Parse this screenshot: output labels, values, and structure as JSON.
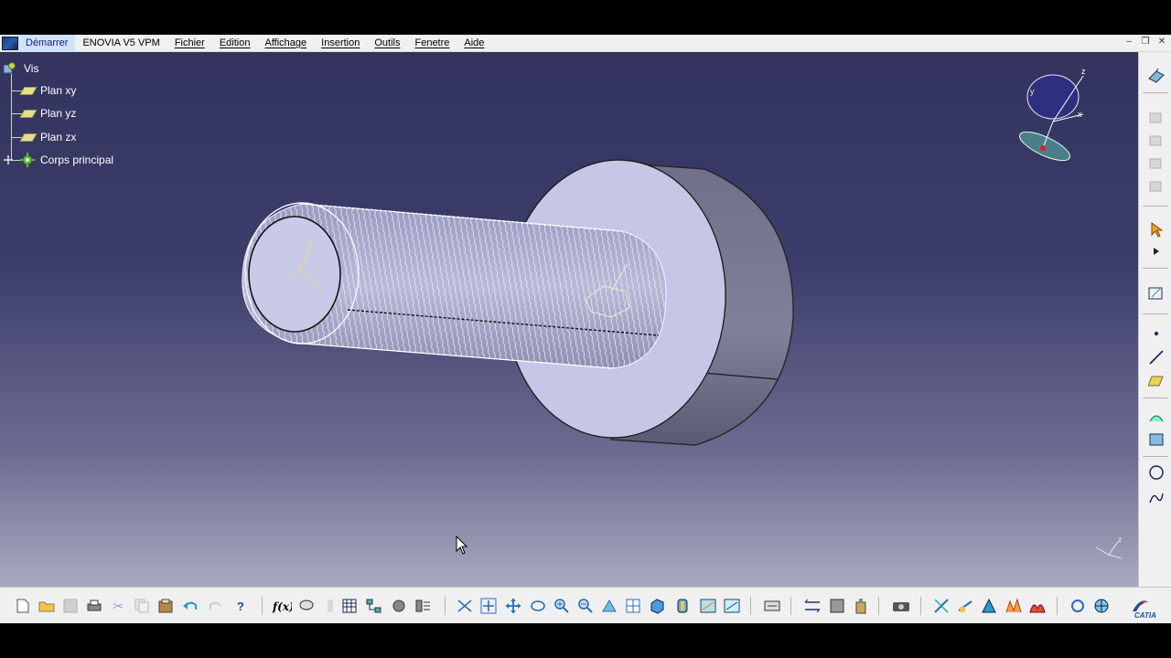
{
  "menu": {
    "items": [
      {
        "label": "Démarrer"
      },
      {
        "label": "ENOVIA V5 VPM"
      },
      {
        "label": "Fichier"
      },
      {
        "label": "Edition"
      },
      {
        "label": "Affichage"
      },
      {
        "label": "Insertion"
      },
      {
        "label": "Outils"
      },
      {
        "label": "Fenetre"
      },
      {
        "label": "Aide"
      }
    ]
  },
  "tree": {
    "root": "Vis",
    "children": [
      "Plan xy",
      "Plan yz",
      "Plan zx",
      "Corps principal"
    ]
  },
  "compass": {
    "x": "x",
    "y": "y",
    "z": "z"
  },
  "brand": "CATIA",
  "colors": {
    "menu_highlight": "#cfe3f7",
    "viewport_top": "#33335e",
    "viewport_bottom": "#a9a9be",
    "part_face": "#c7c8e8",
    "part_side": "#7a7a92",
    "plane_icon": "#e6e08a"
  },
  "icons": {
    "right_toolbar": [
      "sketcher-icon",
      "sketch-plane-icon",
      "constraints-icon",
      "parts-icon",
      "part2-icon",
      "part3-icon",
      "select-arrow-icon",
      "expand-arrow-icon",
      "sketch-icon",
      "point-icon",
      "line-icon",
      "plane-icon",
      "surface-icon",
      "multi-icon",
      "circle-icon",
      "spline-icon"
    ],
    "bottom_toolbar": [
      "new-icon",
      "open-icon",
      "save-icon",
      "print-icon",
      "cut-icon",
      "copy-icon",
      "paste-icon",
      "undo-icon",
      "redo-icon",
      "help-icon",
      "formula-icon",
      "comment-icon",
      "table-icon",
      "tree-icon",
      "measure-icon",
      "knowledge-icon",
      "fly-icon",
      "fit-all-icon",
      "pan-icon",
      "rotate-icon",
      "zoom-in-icon",
      "zoom-out-icon",
      "normal-view-icon",
      "multi-view-icon",
      "iso-view-icon",
      "shading-icon",
      "hide-show-icon",
      "swap-icon",
      "update-icon",
      "measure-between-icon",
      "measure-item-icon",
      "measure-inertia-icon",
      "capture-icon",
      "analysis-icon",
      "draft-icon",
      "curvature-icon",
      "thickness-icon",
      "surface-analysis-icon",
      "refresh-icon",
      "catia-logo"
    ]
  }
}
